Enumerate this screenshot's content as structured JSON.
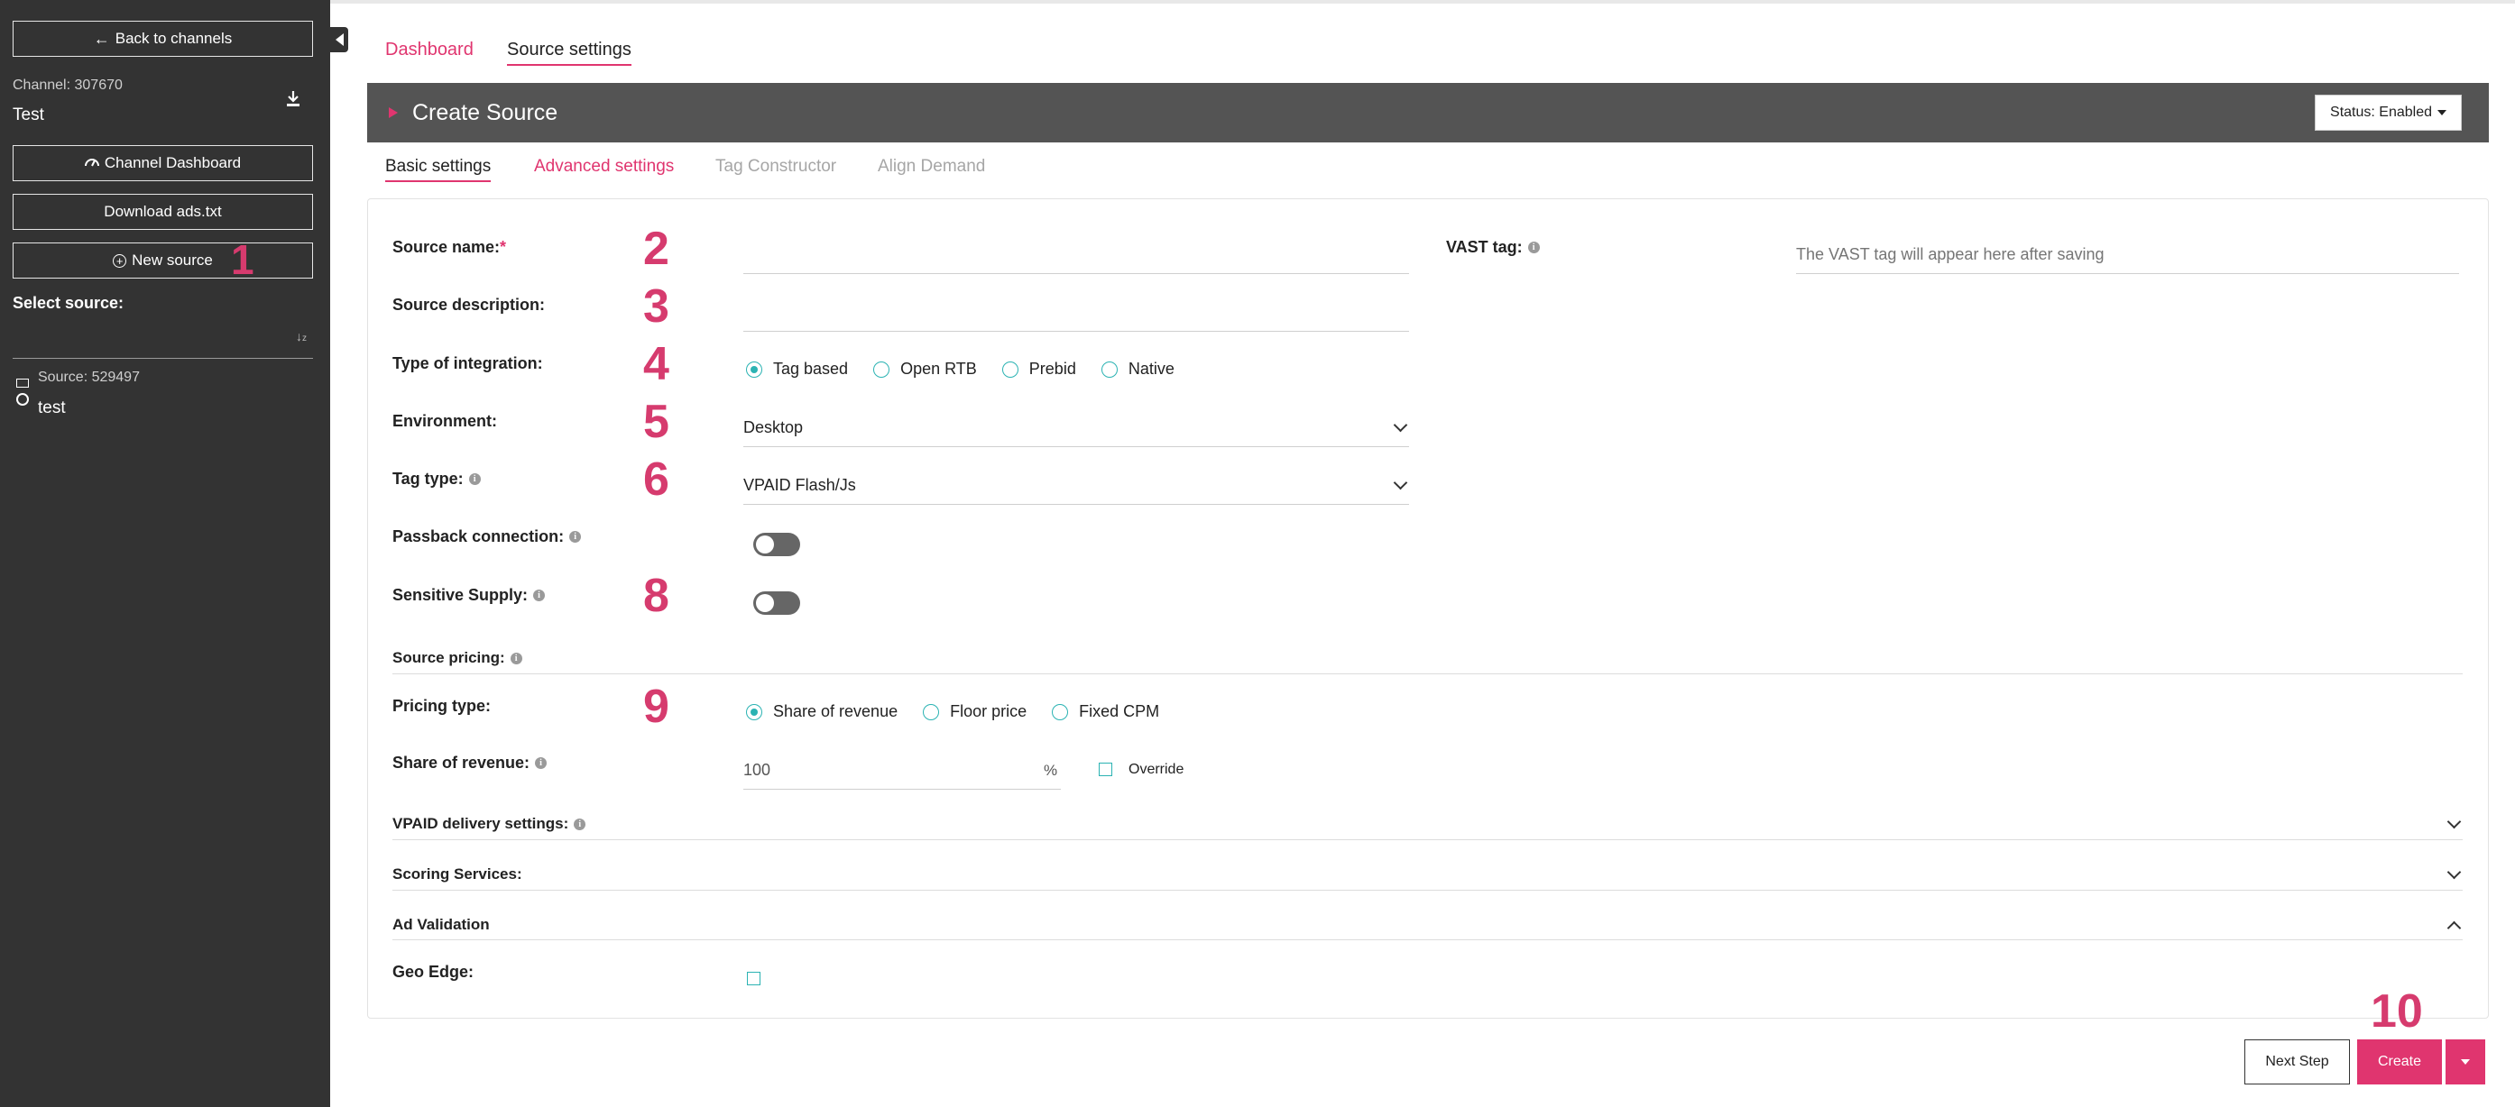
{
  "sidebar": {
    "back_label": "Back to channels",
    "channel_id": "Channel: 307670",
    "channel_name": "Test",
    "channel_dashboard_label": "Channel Dashboard",
    "download_ads_label": "Download ads.txt",
    "new_source_label": "New source",
    "select_source_label": "Select source:",
    "sources": [
      {
        "id_label": "Source: 529497",
        "name": "test"
      }
    ]
  },
  "top_tabs": [
    {
      "label": "Dashboard",
      "active": false
    },
    {
      "label": "Source settings",
      "active": true
    }
  ],
  "header": {
    "title": "Create Source",
    "status_label": "Status: Enabled"
  },
  "sub_tabs": [
    {
      "label": "Basic settings",
      "state": "active"
    },
    {
      "label": "Advanced settings",
      "state": "link"
    },
    {
      "label": "Tag Constructor",
      "state": "disabled"
    },
    {
      "label": "Align Demand",
      "state": "disabled"
    }
  ],
  "form": {
    "source_name_label": "Source name:",
    "required_mark": "*",
    "source_name_value": "",
    "source_description_label": "Source description:",
    "source_description_value": "",
    "type_of_integration_label": "Type of integration:",
    "integration_options": [
      "Tag based",
      "Open RTB",
      "Prebid",
      "Native"
    ],
    "integration_selected": "Tag based",
    "environment_label": "Environment:",
    "environment_value": "Desktop",
    "tag_type_label": "Tag type:",
    "tag_type_value": "VPAID Flash/Js",
    "passback_label": "Passback connection:",
    "passback_on": false,
    "sensitive_supply_label": "Sensitive Supply:",
    "sensitive_supply_on": false,
    "vast_tag_label": "VAST tag:",
    "vast_tag_placeholder": "The VAST tag will appear here after saving",
    "source_pricing_label": "Source pricing:",
    "pricing_type_label": "Pricing type:",
    "pricing_options": [
      "Share of revenue",
      "Floor price",
      "Fixed CPM"
    ],
    "pricing_selected": "Share of revenue",
    "share_of_revenue_label": "Share of revenue:",
    "share_of_revenue_value": "100",
    "percent_sign": "%",
    "override_label": "Override",
    "vpaid_delivery_label": "VPAID delivery settings:",
    "scoring_services_label": "Scoring Services:",
    "ad_validation_label": "Ad Validation",
    "geo_edge_label": "Geo Edge:"
  },
  "step_markers": [
    "1",
    "2",
    "3",
    "4",
    "5",
    "6",
    "8",
    "9",
    "10"
  ],
  "footer": {
    "next_step_label": "Next Step",
    "create_label": "Create"
  },
  "colors": {
    "accent": "#e0356f",
    "sidebar_bg": "#333333",
    "header_bg": "#545454",
    "radio": "#2bb3b3"
  }
}
